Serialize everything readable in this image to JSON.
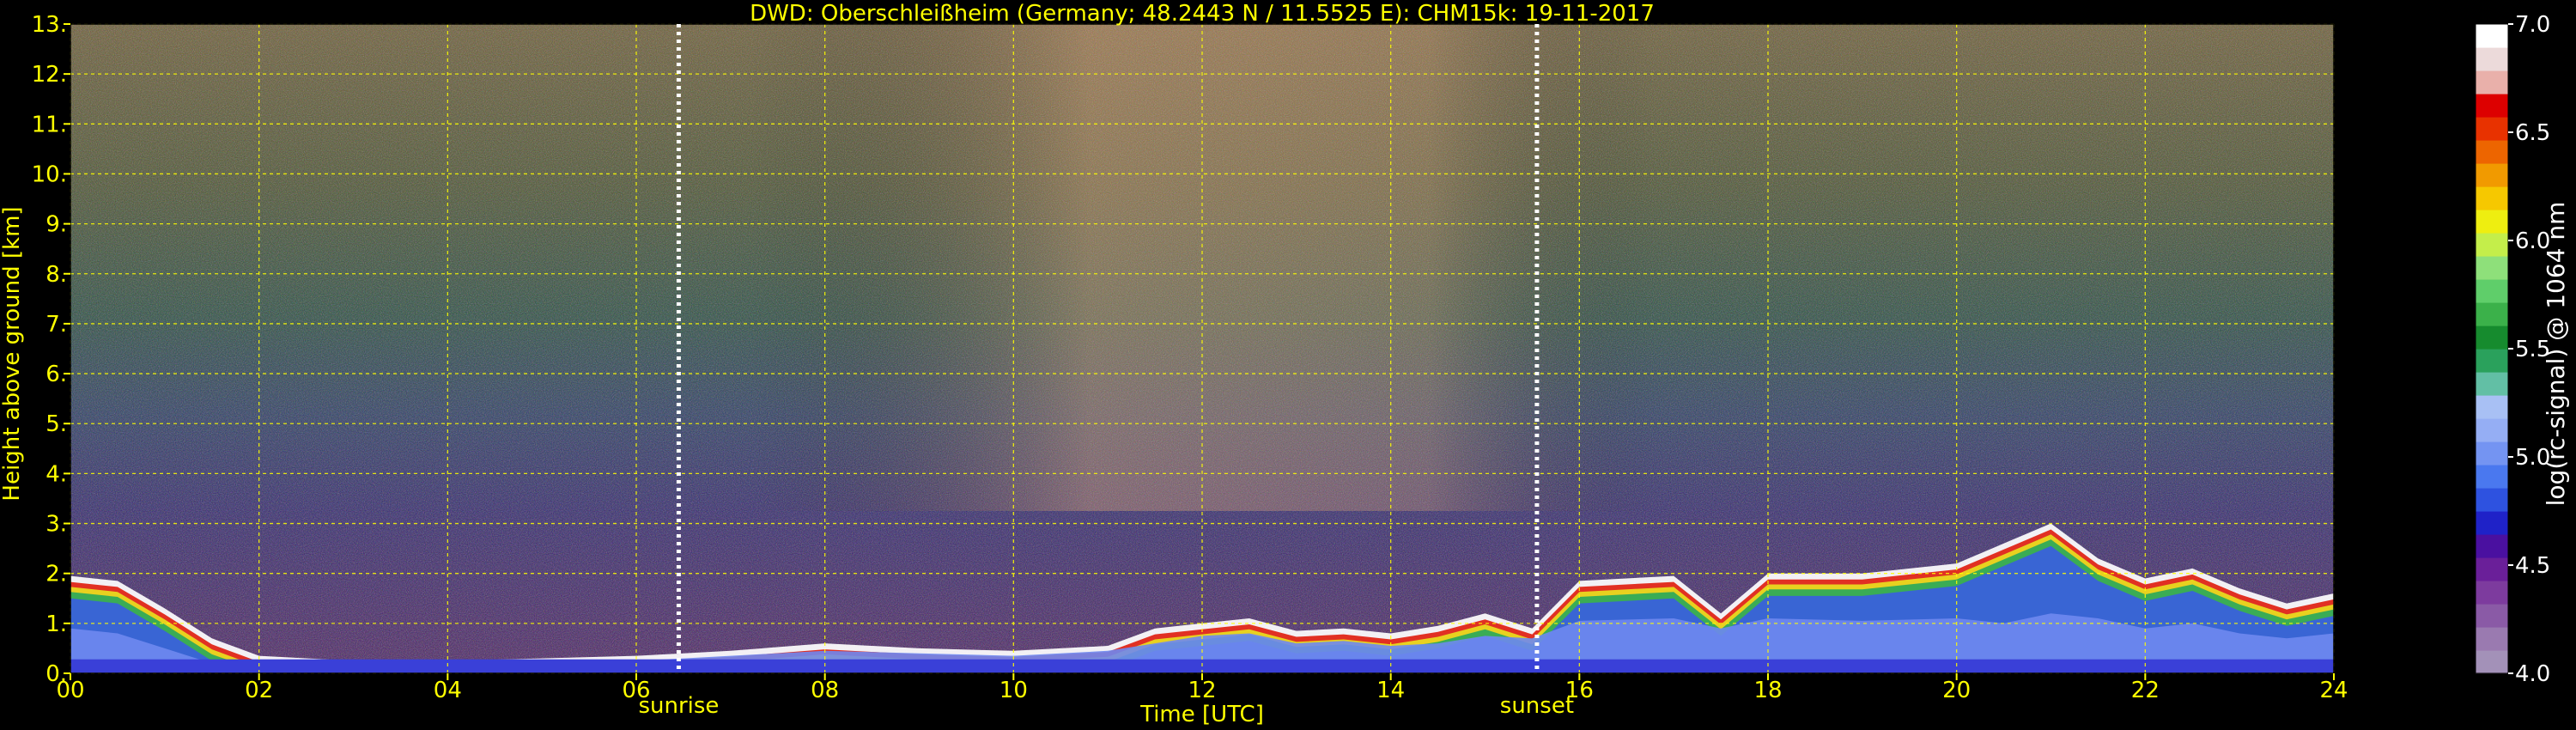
{
  "chart_data": {
    "type": "heatmap",
    "title": "DWD: Oberschleißheim (Germany; 48.2443 N / 11.5525 E):    CHM15k: 19-11-2017",
    "xlabel": "Time [UTC]",
    "ylabel": "Height above ground [km]",
    "xlim": [
      0,
      24
    ],
    "ylim": [
      0,
      13
    ],
    "x_ticks": [
      "00",
      "02",
      "04",
      "06",
      "08",
      "10",
      "12",
      "14",
      "16",
      "18",
      "20",
      "22",
      "24"
    ],
    "y_ticks": [
      "0.",
      "1.",
      "2.",
      "3.",
      "4.",
      "5.",
      "6.",
      "7.",
      "8.",
      "9.",
      "10.",
      "11.",
      "12.",
      "13."
    ],
    "grid": true,
    "events": [
      {
        "label": "sunrise",
        "time_utc": 6.45
      },
      {
        "label": "sunset",
        "time_utc": 15.55
      }
    ],
    "colorbar": {
      "label": "log(rc-signal) @ 1064 nm",
      "range": [
        4.0,
        7.0
      ],
      "ticks": [
        "4.0",
        "4.5",
        "5.0",
        "5.5",
        "6.0",
        "6.5",
        "7.0"
      ],
      "colors": [
        "#a391b8",
        "#9a7ab0",
        "#8a5aa6",
        "#7d3b9e",
        "#6a1f99",
        "#4a10a0",
        "#1f22c8",
        "#2e52e0",
        "#4a78ef",
        "#7494f2",
        "#95aef4",
        "#a8c0f4",
        "#62bfa5",
        "#2aa15c",
        "#168b2e",
        "#3bb14a",
        "#5fce6a",
        "#8ee07a",
        "#c4ee4a",
        "#eeee10",
        "#f6c800",
        "#f19a00",
        "#ed6500",
        "#e83200",
        "#dd0000",
        "#e9b0aa",
        "#ecdada",
        "#ffffff"
      ]
    },
    "profile": {
      "times": [
        0,
        0.5,
        1,
        1.5,
        2,
        3,
        4,
        5,
        6,
        6.5,
        7,
        8,
        9,
        10,
        11,
        11.5,
        12,
        12.5,
        13,
        13.5,
        14,
        14.5,
        15,
        15.5,
        16,
        17,
        17.5,
        18,
        19,
        20,
        20.5,
        21,
        21.5,
        22,
        22.5,
        23,
        23.5,
        24
      ],
      "cloud_top_km": [
        1.95,
        1.85,
        1.3,
        0.7,
        0.35,
        0.25,
        0.25,
        0.3,
        0.35,
        0.4,
        0.45,
        0.6,
        0.5,
        0.45,
        0.55,
        0.9,
        1.0,
        1.1,
        0.85,
        0.9,
        0.8,
        0.95,
        1.2,
        0.9,
        1.85,
        1.95,
        1.2,
        2.0,
        2.0,
        2.2,
        2.6,
        3.0,
        2.3,
        1.9,
        2.1,
        1.7,
        1.4,
        1.6
      ],
      "base_layer_top_km": [
        0.9,
        0.8,
        0.5,
        0.2,
        0.15,
        0.15,
        0.15,
        0.2,
        0.25,
        0.3,
        0.35,
        0.45,
        0.4,
        0.35,
        0.45,
        0.6,
        0.75,
        0.8,
        0.6,
        0.65,
        0.55,
        0.6,
        0.75,
        0.7,
        1.05,
        1.1,
        0.9,
        1.1,
        1.05,
        1.1,
        1.0,
        1.2,
        1.1,
        0.9,
        1.0,
        0.8,
        0.7,
        0.8
      ]
    }
  }
}
